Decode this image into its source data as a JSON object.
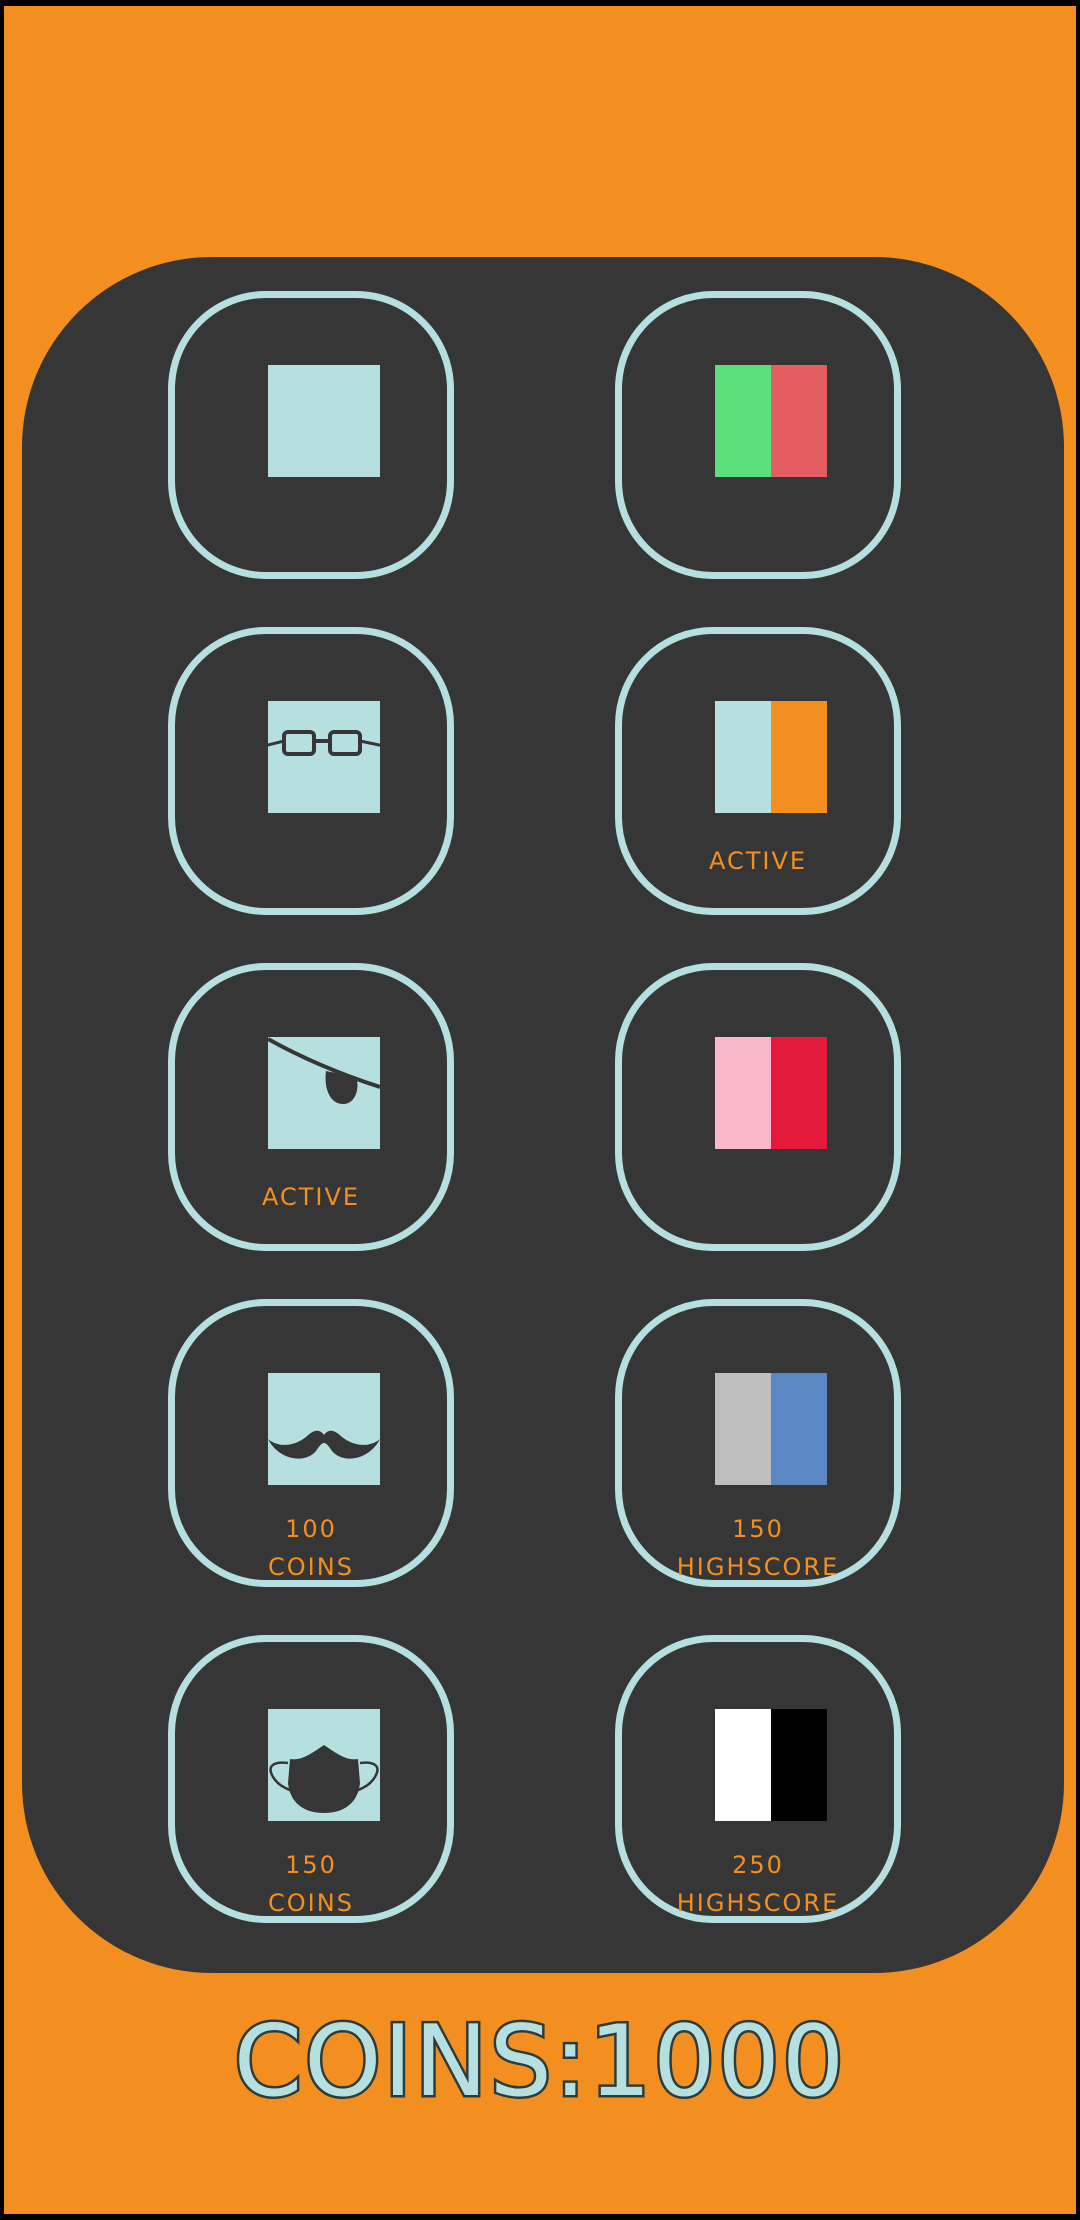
{
  "colors": {
    "background": "#f38f21",
    "panel": "#363636",
    "tile_border": "#b6e0e0",
    "caption": "#f38f21",
    "skin": "#b6e0e0",
    "feature": "#363636"
  },
  "items": [
    {
      "kind": "face",
      "accessory": "none",
      "icon": "plain-face-icon"
    },
    {
      "kind": "colors",
      "left": "#5be07b",
      "right": "#e35d61",
      "icon": "green-red-swatch-icon"
    },
    {
      "kind": "face",
      "accessory": "glasses",
      "icon": "glasses-face-icon"
    },
    {
      "kind": "colors",
      "left": "#b6e0e0",
      "right": "#f38f21",
      "icon": "teal-orange-swatch-icon",
      "status": "ACTIVE"
    },
    {
      "kind": "face",
      "accessory": "eyepatch",
      "icon": "eyepatch-face-icon",
      "status": "ACTIVE"
    },
    {
      "kind": "colors",
      "left": "#f9b7cc",
      "right": "#e31a3a",
      "icon": "pink-red-swatch-icon"
    },
    {
      "kind": "face",
      "accessory": "mustache",
      "icon": "mustache-face-icon",
      "price": "100",
      "unit": "COINS"
    },
    {
      "kind": "colors",
      "left": "#bebebf",
      "right": "#5b87c5",
      "icon": "gray-blue-swatch-icon",
      "price": "150",
      "unit": "HIGHSCORE"
    },
    {
      "kind": "face",
      "accessory": "mask",
      "icon": "mask-face-icon",
      "price": "150",
      "unit": "COINS"
    },
    {
      "kind": "colors",
      "left": "#ffffff",
      "right": "#000000",
      "icon": "white-black-swatch-icon",
      "price": "250",
      "unit": "HIGHSCORE"
    }
  ],
  "coins_label": "COINS:1000"
}
